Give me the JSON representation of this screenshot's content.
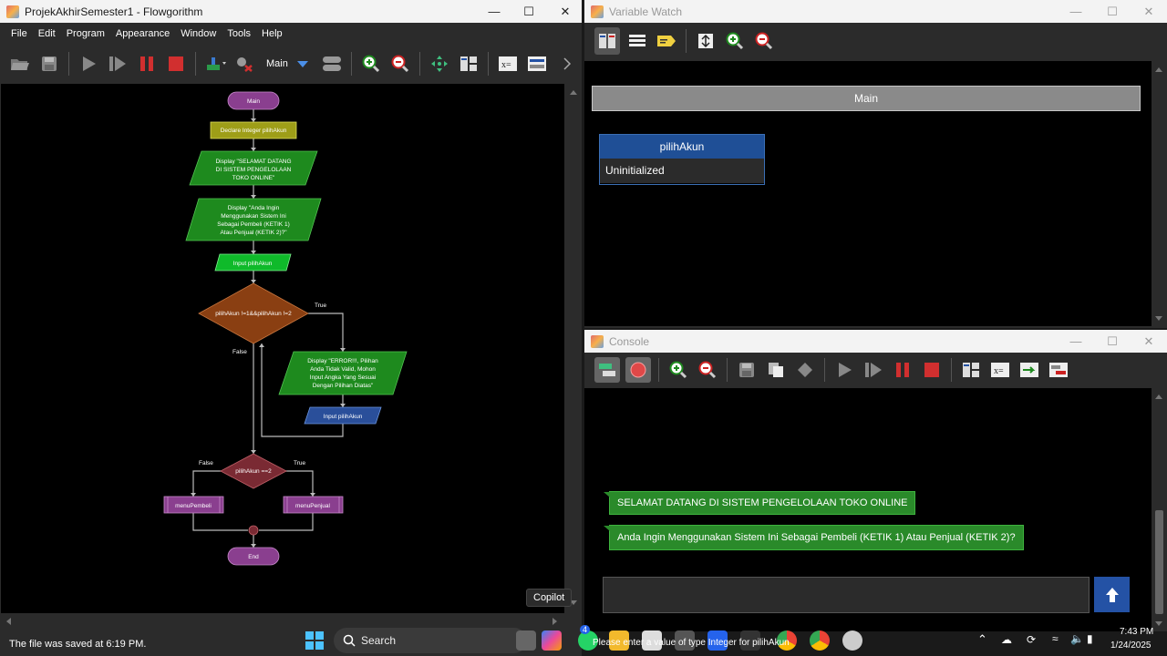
{
  "flowgorithm": {
    "title": "ProjekAkhirSemester1 - Flowgorithm",
    "menu": [
      "File",
      "Edit",
      "Program",
      "Appearance",
      "Window",
      "Tools",
      "Help"
    ],
    "function_select": "Main",
    "status": "The file was saved at 6:19 PM.",
    "flowchart": {
      "start": "Main",
      "declare": "Declare Integer pilihAkun",
      "output1": [
        "Display \"SELAMAT DATANG",
        "DI SISTEM PENGELOLAAN",
        "TOKO ONLINE\""
      ],
      "output2": [
        "Display \"Anda Ingin",
        "Menggunakan Sistem Ini",
        "Sebagai Pembeli (KETIK 1)",
        "Atau Penjual (KETIK 2)?\""
      ],
      "input1": "Input pilihAkun",
      "loop_cond": "pilihAkun !=1&&pilihAkun !=2",
      "loop_true": "True",
      "loop_false": "False",
      "output3": [
        "Display \"ERROR!!!, Pilihan",
        "Anda Tidak Valid, Mohon",
        "Input Angka Yang Sesuai",
        "Dengan Pilihan Diatas\""
      ],
      "input2": "Input pilihAkun",
      "if_cond": "pilihAkun ==2",
      "if_false": "False",
      "if_true": "True",
      "call_left": "menuPembeli",
      "call_right": "menuPenjual",
      "end": "End"
    }
  },
  "variable_watch": {
    "title": "Variable Watch",
    "frame": "Main",
    "variable": {
      "name": "pilihAkun",
      "value": "Uninitialized"
    }
  },
  "console": {
    "title": "Console",
    "messages": [
      "SELAMAT DATANG DI SISTEM PENGELOLAAN TOKO ONLINE",
      "Anda Ingin Menggunakan Sistem Ini Sebagai Pembeli (KETIK 1) Atau Penjual (KETIK 2)?"
    ],
    "input_hint": "Please enter a value of type Integer for pilihAkun"
  },
  "taskbar": {
    "search_placeholder": "Search",
    "tooltip": "Copilot",
    "time": "7:43 PM",
    "date": "1/24/2025",
    "whatsapp_badge": "4"
  },
  "colors": {
    "output_green": "#1e8a1e",
    "input_green": "#0fba2a",
    "terminal_purple": "#8a3f8f",
    "declare_yellow": "#9e9e18",
    "loop_brown": "#8a3f12",
    "if_maroon": "#7a2a33",
    "input_blue": "#2a4f9a",
    "accent_blue": "#2452a5"
  }
}
